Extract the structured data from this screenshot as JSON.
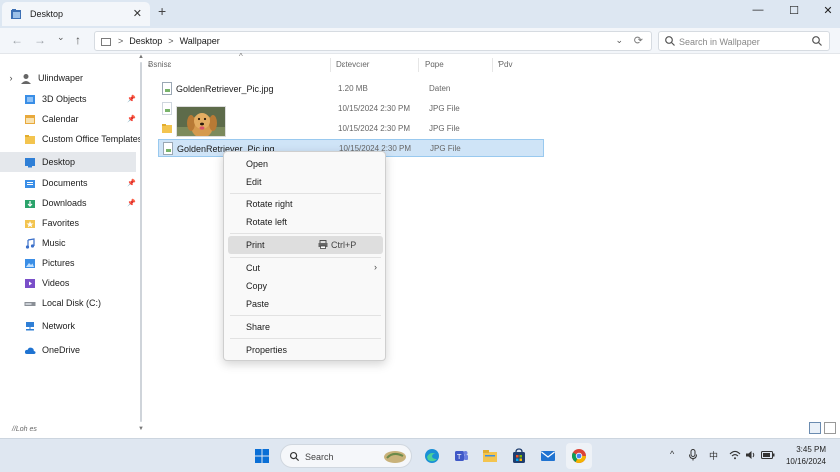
{
  "window": {
    "tab_title": "Desktop",
    "new_tab": "+",
    "close_tab": "✕",
    "minimize": "—",
    "maximize": "☐",
    "close": "✕"
  },
  "nav": {
    "back": "←",
    "forward": "→",
    "dropdown": "⌄",
    "up": "↑",
    "breadcrumb": [
      "Desktop",
      "Wallpaper"
    ],
    "separator": ">",
    "addr_dropdown": "⌄",
    "refresh": "⟳",
    "search_placeholder": "Search in Wallpaper"
  },
  "sidebar": {
    "items": [
      {
        "label": "Ulindwaper",
        "icon": "user-icon"
      },
      {
        "label": "3D Objects",
        "icon": "cube-icon",
        "pinned": true
      },
      {
        "label": "Calendar",
        "icon": "calendar-icon",
        "pinned": true
      },
      {
        "label": "Custom Office Templates",
        "icon": "folder-icon"
      },
      {
        "label": "Desktop",
        "icon": "desktop-icon",
        "selected": true
      },
      {
        "label": "Documents",
        "icon": "documents-icon",
        "pinned": true
      },
      {
        "label": "Downloads",
        "icon": "downloads-icon",
        "pinned": true
      },
      {
        "label": "Favorites",
        "icon": "star-icon"
      },
      {
        "label": "Music",
        "icon": "music-icon"
      },
      {
        "label": "Pictures",
        "icon": "pictures-icon"
      },
      {
        "label": "Videos",
        "icon": "videos-icon"
      },
      {
        "label": "Local Disk (C:)",
        "icon": "disk-icon"
      },
      {
        "label": "Network",
        "icon": "network-icon"
      },
      {
        "label": "OneDrive",
        "icon": "cloud-icon"
      }
    ],
    "expand": "›",
    "pin": "📌",
    "status": "//Loh es"
  },
  "columns": {
    "name": "Ƀsnisɛ",
    "date": "Dɛtevcıer",
    "type": "Pɑpe",
    "size": "Ƥdv"
  },
  "files": [
    {
      "name": "GoldenRetriever_Pic.jpg",
      "date": "1.20 MB",
      "type": "Daten"
    },
    {
      "name": "",
      "date": "10/15/2024 2:30 PM",
      "type": "JPG File"
    },
    {
      "name": "",
      "date": "10/15/2024 2:30 PM",
      "type": "JPG File"
    },
    {
      "name": "GoldenRetriever_Pic.jpg",
      "date": "10/15/2024 2:30 PM",
      "type": "JPG File",
      "selected": true
    }
  ],
  "context_menu": {
    "open": "Open",
    "edit": "Edit",
    "rotate_right": "Rotate right",
    "rotate_left": "Rotate left",
    "print": "Print",
    "print_shortcut": "Ctrl+P",
    "cut": "Cut",
    "copy": "Copy",
    "paste": "Paste",
    "share": "Share",
    "properties": "Properties",
    "submenu_arrow": "›"
  },
  "taskbar": {
    "search_placeholder": "Search",
    "tray_chevron": "^",
    "ime": "中",
    "time": "3:45 PM",
    "date": "10/16/2024"
  },
  "colors": {
    "accent": "#0078d4",
    "selection": "#cfe4f7",
    "taskbar": "#dfe7f1"
  }
}
